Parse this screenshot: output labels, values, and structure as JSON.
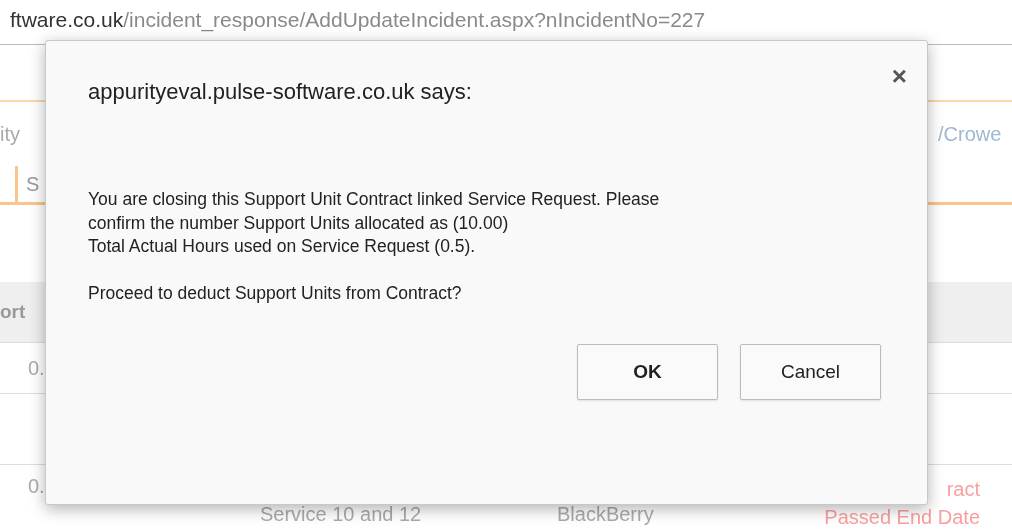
{
  "browser": {
    "url_host": "ftware.co.uk",
    "url_path": "/incident_response/AddUpdateIncident.aspx?nIncidentNo=227"
  },
  "page": {
    "row_1": {
      "left": "ity",
      "right": "/Crowe"
    },
    "tab_label": "S",
    "table": {
      "header": "ort",
      "rows": [
        {
          "column_1": "0.",
          "column_2": "",
          "column_3": "",
          "column_4": []
        },
        {
          "column_1": "0.",
          "column_2": "Service 10 and 12",
          "column_3": "BlackBerry",
          "column_4": [
            "ract",
            "Passed End Date"
          ]
        }
      ]
    }
  },
  "dialog": {
    "title": "appurityeval.pulse-software.co.uk says:",
    "close": "×",
    "message": [
      "You are closing this Support Unit Contract linked Service Request. Please\nconfirm the number Support Units allocated as (10.00)\nTotal Actual Hours used on Service Request (0.5).",
      "Proceed to deduct Support Units from Contract?"
    ],
    "buttons": [
      {
        "label": "OK",
        "default": true
      },
      {
        "label": "Cancel",
        "default": false
      }
    ]
  }
}
